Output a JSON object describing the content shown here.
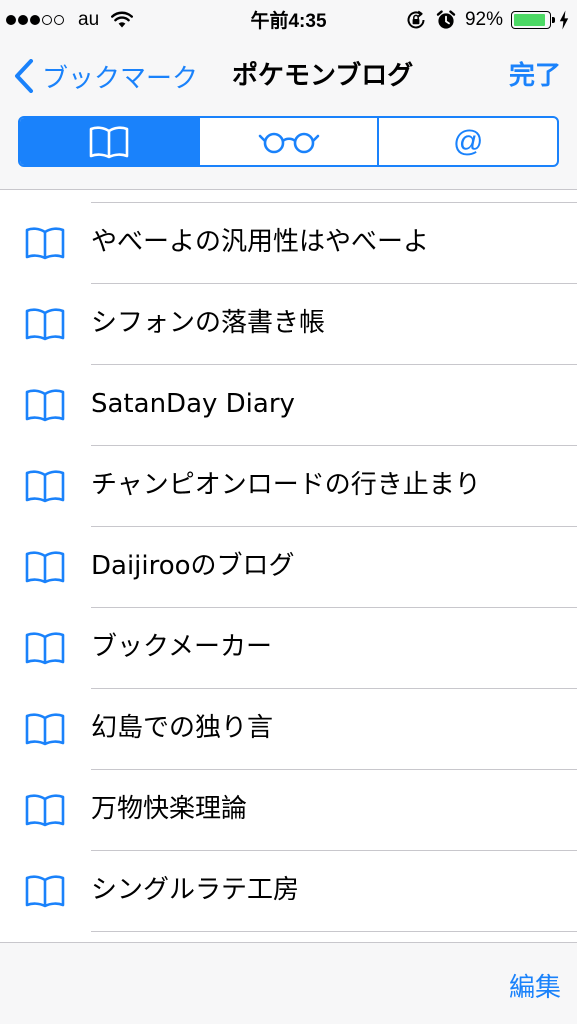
{
  "status_bar": {
    "carrier": "au",
    "time": "午前4:35",
    "battery_percent": "92%",
    "battery_level": 0.92,
    "signal_bars": 3,
    "signal_total": 5
  },
  "nav": {
    "back_label": "ブックマーク",
    "title": "ポケモンブログ",
    "done_label": "完了"
  },
  "segments": [
    {
      "icon": "book-icon",
      "selected": true
    },
    {
      "icon": "reading-glasses-icon",
      "selected": false
    },
    {
      "icon": "at-sign-icon",
      "label": "@",
      "selected": false
    }
  ],
  "bookmarks": [
    {
      "label": "やべーよの汎用性はやべーよ",
      "icon": "book-icon"
    },
    {
      "label": "シフォンの落書き帳",
      "icon": "book-icon"
    },
    {
      "label": "SatanDay Diary",
      "icon": "book-icon"
    },
    {
      "label": "チャンピオンロードの行き止まり",
      "icon": "book-icon"
    },
    {
      "label": "Daijirooのブログ",
      "icon": "book-icon"
    },
    {
      "label": "ブックメーカー",
      "icon": "book-icon"
    },
    {
      "label": "幻島での独り言",
      "icon": "book-icon"
    },
    {
      "label": "万物快楽理論",
      "icon": "book-icon"
    },
    {
      "label": "シングルラテ工房",
      "icon": "book-icon"
    }
  ],
  "toolbar": {
    "edit_label": "編集"
  },
  "colors": {
    "accent": "#1a82fb",
    "battery": "#4cd964",
    "separator": "#c8c7cc",
    "bar_background": "#f7f7f8"
  }
}
